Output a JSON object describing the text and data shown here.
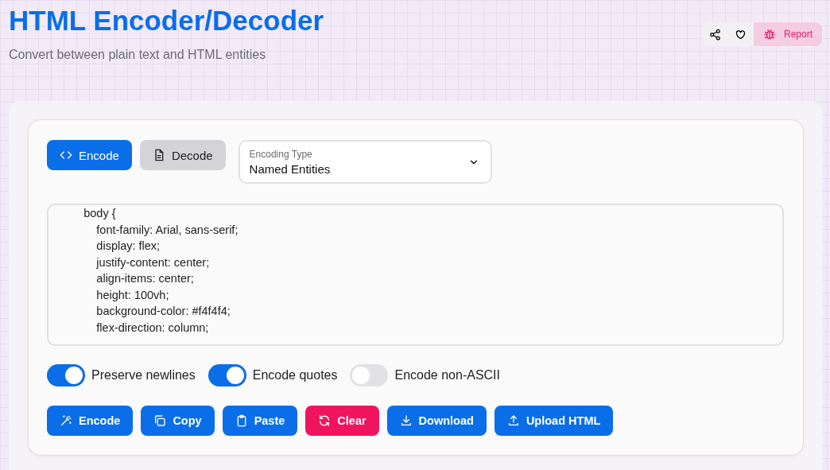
{
  "header": {
    "title": "HTML Encoder/Decoder",
    "subtitle": "Convert between plain text and HTML entities",
    "report_label": "Report"
  },
  "mode_tabs": [
    {
      "label": "Encode",
      "selected": true
    },
    {
      "label": "Decode",
      "selected": false
    }
  ],
  "encoding_type": {
    "label": "Encoding Type",
    "value": "Named Entities"
  },
  "input": {
    "lines": [
      "        body {",
      "            font-family: Arial, sans-serif;",
      "            display: flex;",
      "            justify-content: center;",
      "            align-items: center;",
      "            height: 100vh;",
      "            background-color: #f4f4f4;",
      "            flex-direction: column;"
    ]
  },
  "options": [
    {
      "label": "Preserve newlines",
      "on": true
    },
    {
      "label": "Encode quotes",
      "on": true
    },
    {
      "label": "Encode non-ASCII",
      "on": false
    }
  ],
  "actions": [
    {
      "label": "Encode",
      "kind": "primary"
    },
    {
      "label": "Copy",
      "kind": "primary"
    },
    {
      "label": "Paste",
      "kind": "primary"
    },
    {
      "label": "Clear",
      "kind": "danger"
    },
    {
      "label": "Download",
      "kind": "primary"
    },
    {
      "label": "Upload HTML",
      "kind": "primary"
    }
  ]
}
